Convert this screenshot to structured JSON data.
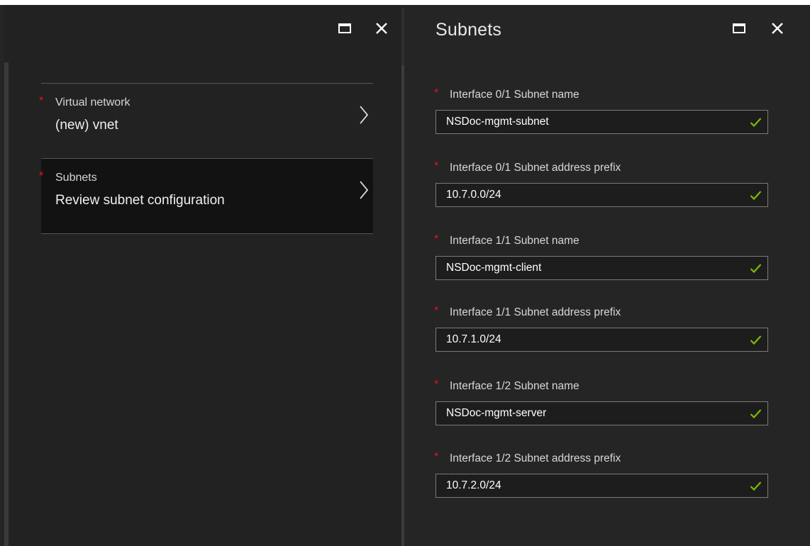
{
  "left_blade": {
    "items": [
      {
        "required_mark": "*",
        "label": "Virtual network",
        "value": "(new) vnet"
      },
      {
        "required_mark": "*",
        "label": "Subnets",
        "value": "Review subnet configuration"
      }
    ]
  },
  "right_blade": {
    "title": "Subnets",
    "fields": [
      {
        "required_mark": "*",
        "label": "Interface 0/1 Subnet name",
        "value": "NSDoc-mgmt-subnet",
        "valid": true
      },
      {
        "required_mark": "*",
        "label": "Interface 0/1 Subnet address prefix",
        "value": "10.7.0.0/24",
        "valid": true
      },
      {
        "required_mark": "*",
        "label": "Interface 1/1 Subnet name",
        "value": "NSDoc-mgmt-client",
        "valid": true
      },
      {
        "required_mark": "*",
        "label": "Interface 1/1 Subnet address prefix",
        "value": "10.7.1.0/24",
        "valid": true
      },
      {
        "required_mark": "*",
        "label": "Interface 1/2 Subnet name",
        "value": "NSDoc-mgmt-server",
        "valid": true
      },
      {
        "required_mark": "*",
        "label": "Interface 1/2 Subnet address prefix",
        "value": "10.7.2.0/24",
        "valid": true
      }
    ]
  },
  "icons": {
    "maximize": "maximize-icon",
    "close": "close-icon",
    "chevron": "chevron-right-icon",
    "check": "checkmark-icon"
  },
  "colors": {
    "background": "#252525",
    "selected_item": "#121212",
    "required": "#e81123",
    "valid_check": "#7fba00",
    "input_border": "#7a7a7a"
  }
}
